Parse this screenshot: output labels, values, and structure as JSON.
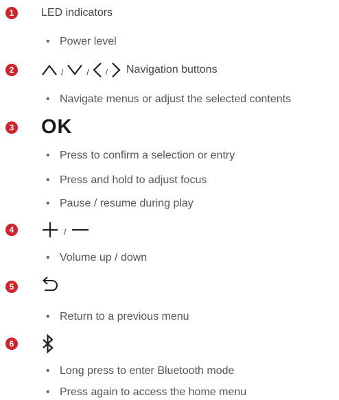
{
  "badge_color": "#d0232a",
  "items": [
    {
      "number": "1",
      "label": "LED indicators",
      "bullets": [
        "Power level"
      ]
    },
    {
      "number": "2",
      "separator_1": "/",
      "separator_2": "/",
      "separator_3": "/",
      "label": "Navigation buttons",
      "icons": [
        "chevron-up-icon",
        "chevron-down-icon",
        "chevron-left-icon",
        "chevron-right-icon"
      ],
      "bullets": [
        "Navigate menus or adjust the selected contents"
      ]
    },
    {
      "number": "3",
      "label": "OK",
      "bullets": [
        "Press to confirm a selection or entry",
        "Press and hold to adjust focus",
        "Pause / resume during play"
      ]
    },
    {
      "number": "4",
      "separator": "/",
      "icons": [
        "plus-icon",
        "minus-icon"
      ],
      "bullets": [
        "Volume up / down"
      ]
    },
    {
      "number": "5",
      "icons": [
        "back-arrow-icon"
      ],
      "bullets": [
        "Return to a previous menu"
      ]
    },
    {
      "number": "6",
      "icons": [
        "bluetooth-icon"
      ],
      "bullets": [
        "Long press to enter Bluetooth mode",
        "Press again to access the home menu"
      ]
    }
  ],
  "bullet_char": "•"
}
